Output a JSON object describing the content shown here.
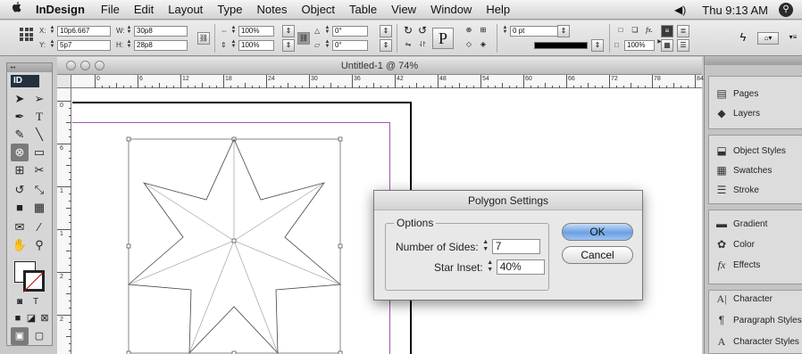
{
  "menubar": {
    "apple": "",
    "app_name": "InDesign",
    "items": [
      "File",
      "Edit",
      "Layout",
      "Type",
      "Notes",
      "Object",
      "Table",
      "View",
      "Window",
      "Help"
    ],
    "volume_icon": "speaker-icon",
    "clock": "Thu 9:13 AM"
  },
  "control_panel": {
    "x_label": "X:",
    "x_value": "10p6.667",
    "y_label": "Y:",
    "y_value": "5p7",
    "w_label": "W:",
    "w_value": "30p8",
    "h_label": "H:",
    "h_value": "28p8",
    "scale_x": "100%",
    "scale_y": "100%",
    "rotate": "0°",
    "shear": "0°",
    "stroke_weight": "0 pt",
    "opacity": "100%"
  },
  "tools_panel": {
    "logo": "ID"
  },
  "document": {
    "title": "Untitled-1 @ 74%",
    "ruler_h": [
      "0",
      "6",
      "12",
      "18",
      "24",
      "30",
      "36",
      "42",
      "48",
      "54",
      "60",
      "66",
      "72",
      "78",
      "84"
    ],
    "ruler_v": [
      "0",
      "6",
      "1",
      "1",
      "2",
      "2",
      "3"
    ]
  },
  "dialog": {
    "title": "Polygon Settings",
    "group_label": "Options",
    "sides_label": "Number of Sides:",
    "sides_value": "7",
    "inset_label": "Star Inset:",
    "inset_value": "40%",
    "ok_label": "OK",
    "cancel_label": "Cancel"
  },
  "panels": {
    "group1": [
      "Pages",
      "Layers"
    ],
    "group2": [
      "Object Styles",
      "Swatches",
      "Stroke"
    ],
    "group3": [
      "Gradient",
      "Color",
      "Effects"
    ],
    "group4": [
      "Character",
      "Paragraph Styles",
      "Character Styles"
    ]
  }
}
